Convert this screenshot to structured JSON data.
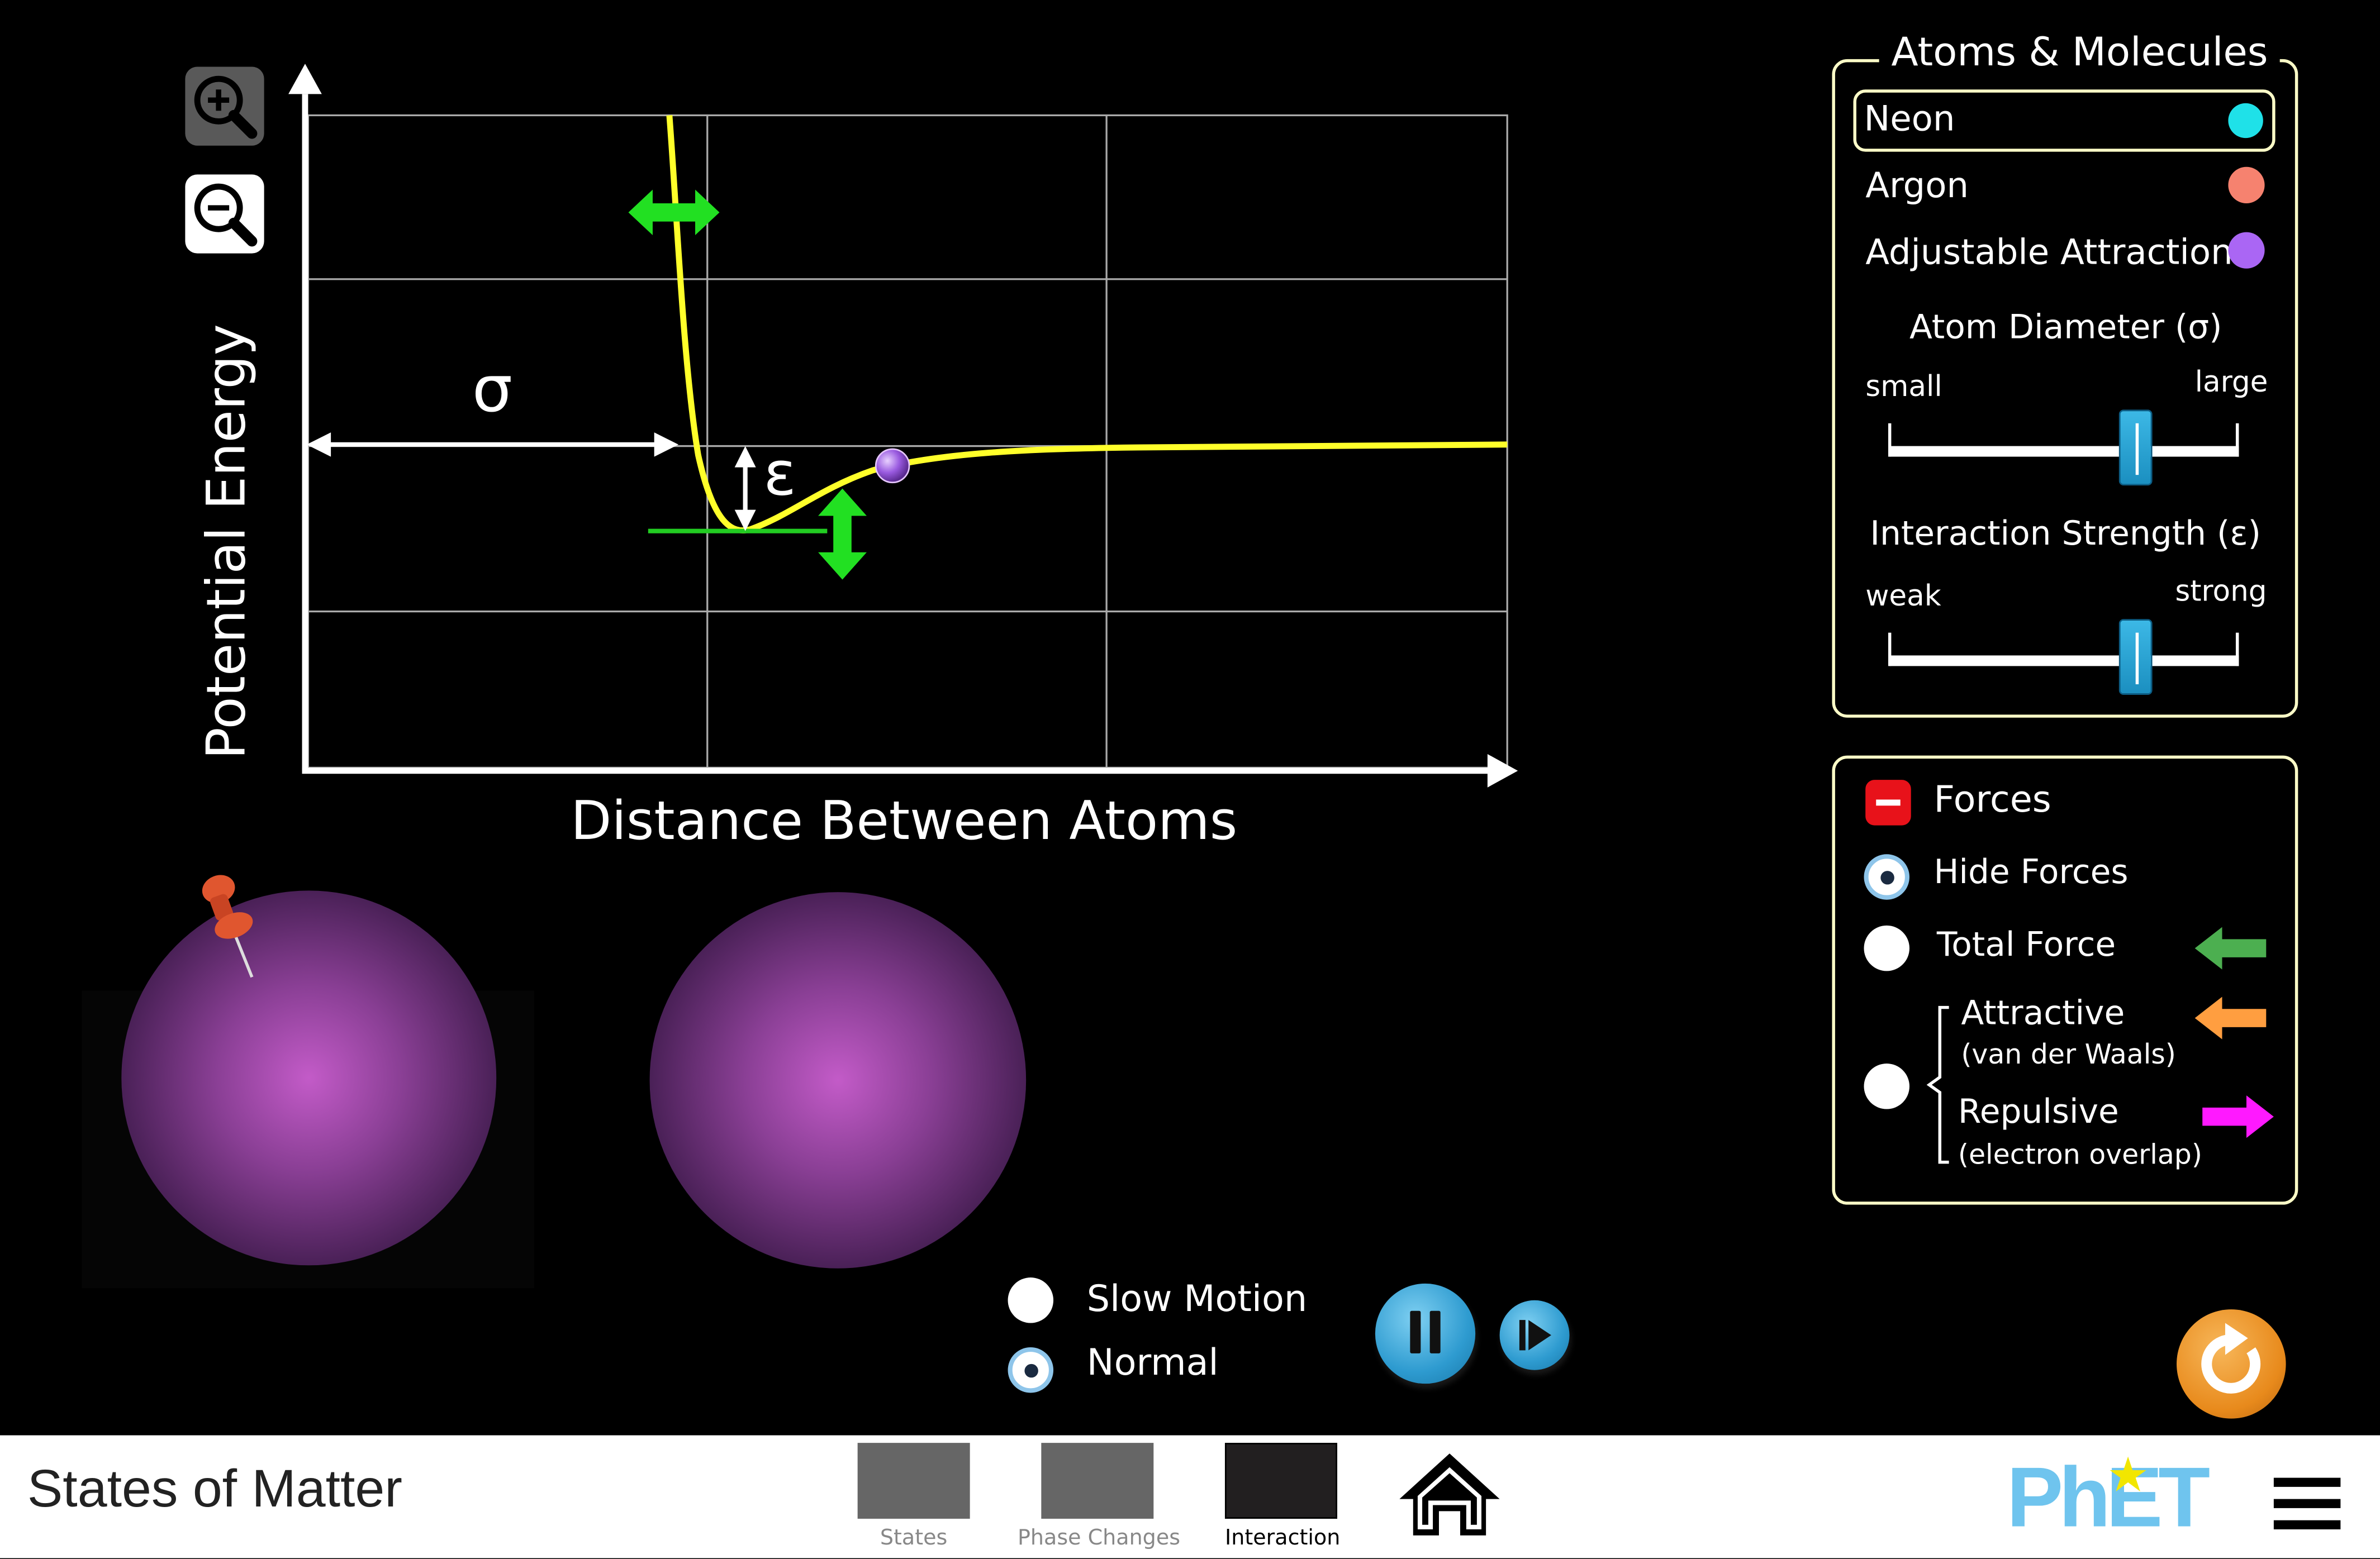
{
  "graph": {
    "x_axis_label": "Distance Between Atoms",
    "y_axis_label": "Potential Energy",
    "sigma_symbol": "σ",
    "epsilon_symbol": "ε"
  },
  "zoom": {
    "zoom_in_icon": "zoom-in-icon",
    "zoom_out_icon": "zoom-out-icon"
  },
  "atoms_panel": {
    "title": "Atoms & Molecules",
    "options": [
      {
        "label": "Neon",
        "color": "#1fe1e8",
        "selected": true
      },
      {
        "label": "Argon",
        "color": "#f6826f",
        "selected": false
      },
      {
        "label": "Adjustable Attraction",
        "color": "#aa66f4",
        "selected": false
      }
    ],
    "diameter_slider": {
      "title": "Atom Diameter (σ)",
      "min_label": "small",
      "max_label": "large",
      "value_fraction": 0.7
    },
    "strength_slider": {
      "title": "Interaction Strength (ε)",
      "min_label": "weak",
      "max_label": "strong",
      "value_fraction": 0.7
    }
  },
  "forces_panel": {
    "title": "Forces",
    "collapse_icon": "minus-icon",
    "options": [
      {
        "label": "Hide Forces",
        "selected": true
      },
      {
        "label": "Total Force",
        "selected": false,
        "arrow_color": "#4caf50"
      },
      {
        "label": "Attractive",
        "sublabel": "(van der Waals)",
        "arrow_color": "#ff9e40"
      },
      {
        "label": "Repulsive",
        "sublabel": "(electron overlap)",
        "arrow_color": "#ff19ff"
      }
    ]
  },
  "time_controls": {
    "options": [
      {
        "label": "Slow Motion",
        "selected": false
      },
      {
        "label": "Normal",
        "selected": true
      }
    ],
    "pause_icon": "pause-icon",
    "step_icon": "step-forward-icon"
  },
  "reset_icon": "reset-icon",
  "navbar": {
    "title": "States of Matter",
    "screens": [
      {
        "label": "States",
        "active": false
      },
      {
        "label": "Phase Changes",
        "active": false
      },
      {
        "label": "Interaction",
        "active": true
      }
    ],
    "home_icon": "home-icon",
    "logo": "PhET",
    "menu_icon": "hamburger-menu-icon"
  }
}
